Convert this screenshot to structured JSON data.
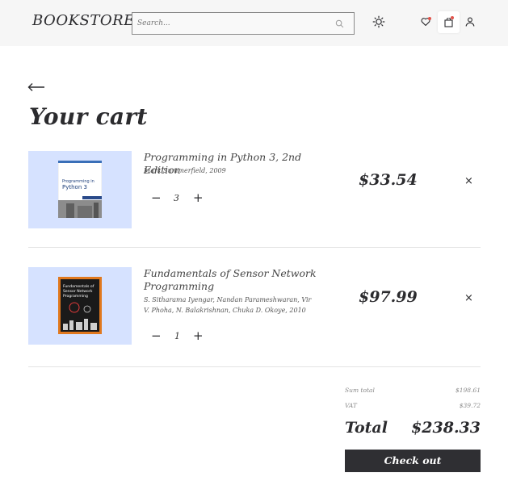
{
  "header": {
    "brand": "BOOKSTORE",
    "search_placeholder": "Search...",
    "icons": [
      "search-icon",
      "theme-sun-icon",
      "heart-icon",
      "bag-icon",
      "user-icon"
    ],
    "badge_color": "#e0524a"
  },
  "main": {
    "title": "Your cart",
    "items": [
      {
        "title": "Programming in Python 3, 2nd Edition",
        "author": "Mark Summerfield, 2009",
        "quantity": "3",
        "price": "$33.54",
        "cover_text": [
          "Programming in",
          "Python 3"
        ]
      },
      {
        "title": "Fundamentals of Sensor Network Programming",
        "author": "S. Sitharama Iyengar, Nandan Parameshwaran, Vir V. Phoha, N. Balakrishnan, Chuka D. Okoye, 2010",
        "quantity": "1",
        "price": "$97.99",
        "cover_text": [
          "Fundamentals of",
          "Sensor Network",
          "Programming"
        ]
      }
    ],
    "qty_minus": "−",
    "qty_plus": "+",
    "remove_symbol": "×"
  },
  "summary": {
    "sum_label": "Sum total",
    "sum_value": "$198.61",
    "vat_label": "VAT",
    "vat_value": "$39.72",
    "total_label": "Total",
    "total_value": "$238.33",
    "checkout_label": "Check out"
  },
  "colors": {
    "header_bg": "#f6f6f6",
    "thumb_bg": "#d6e2ff",
    "button_bg": "#2f2f33"
  }
}
